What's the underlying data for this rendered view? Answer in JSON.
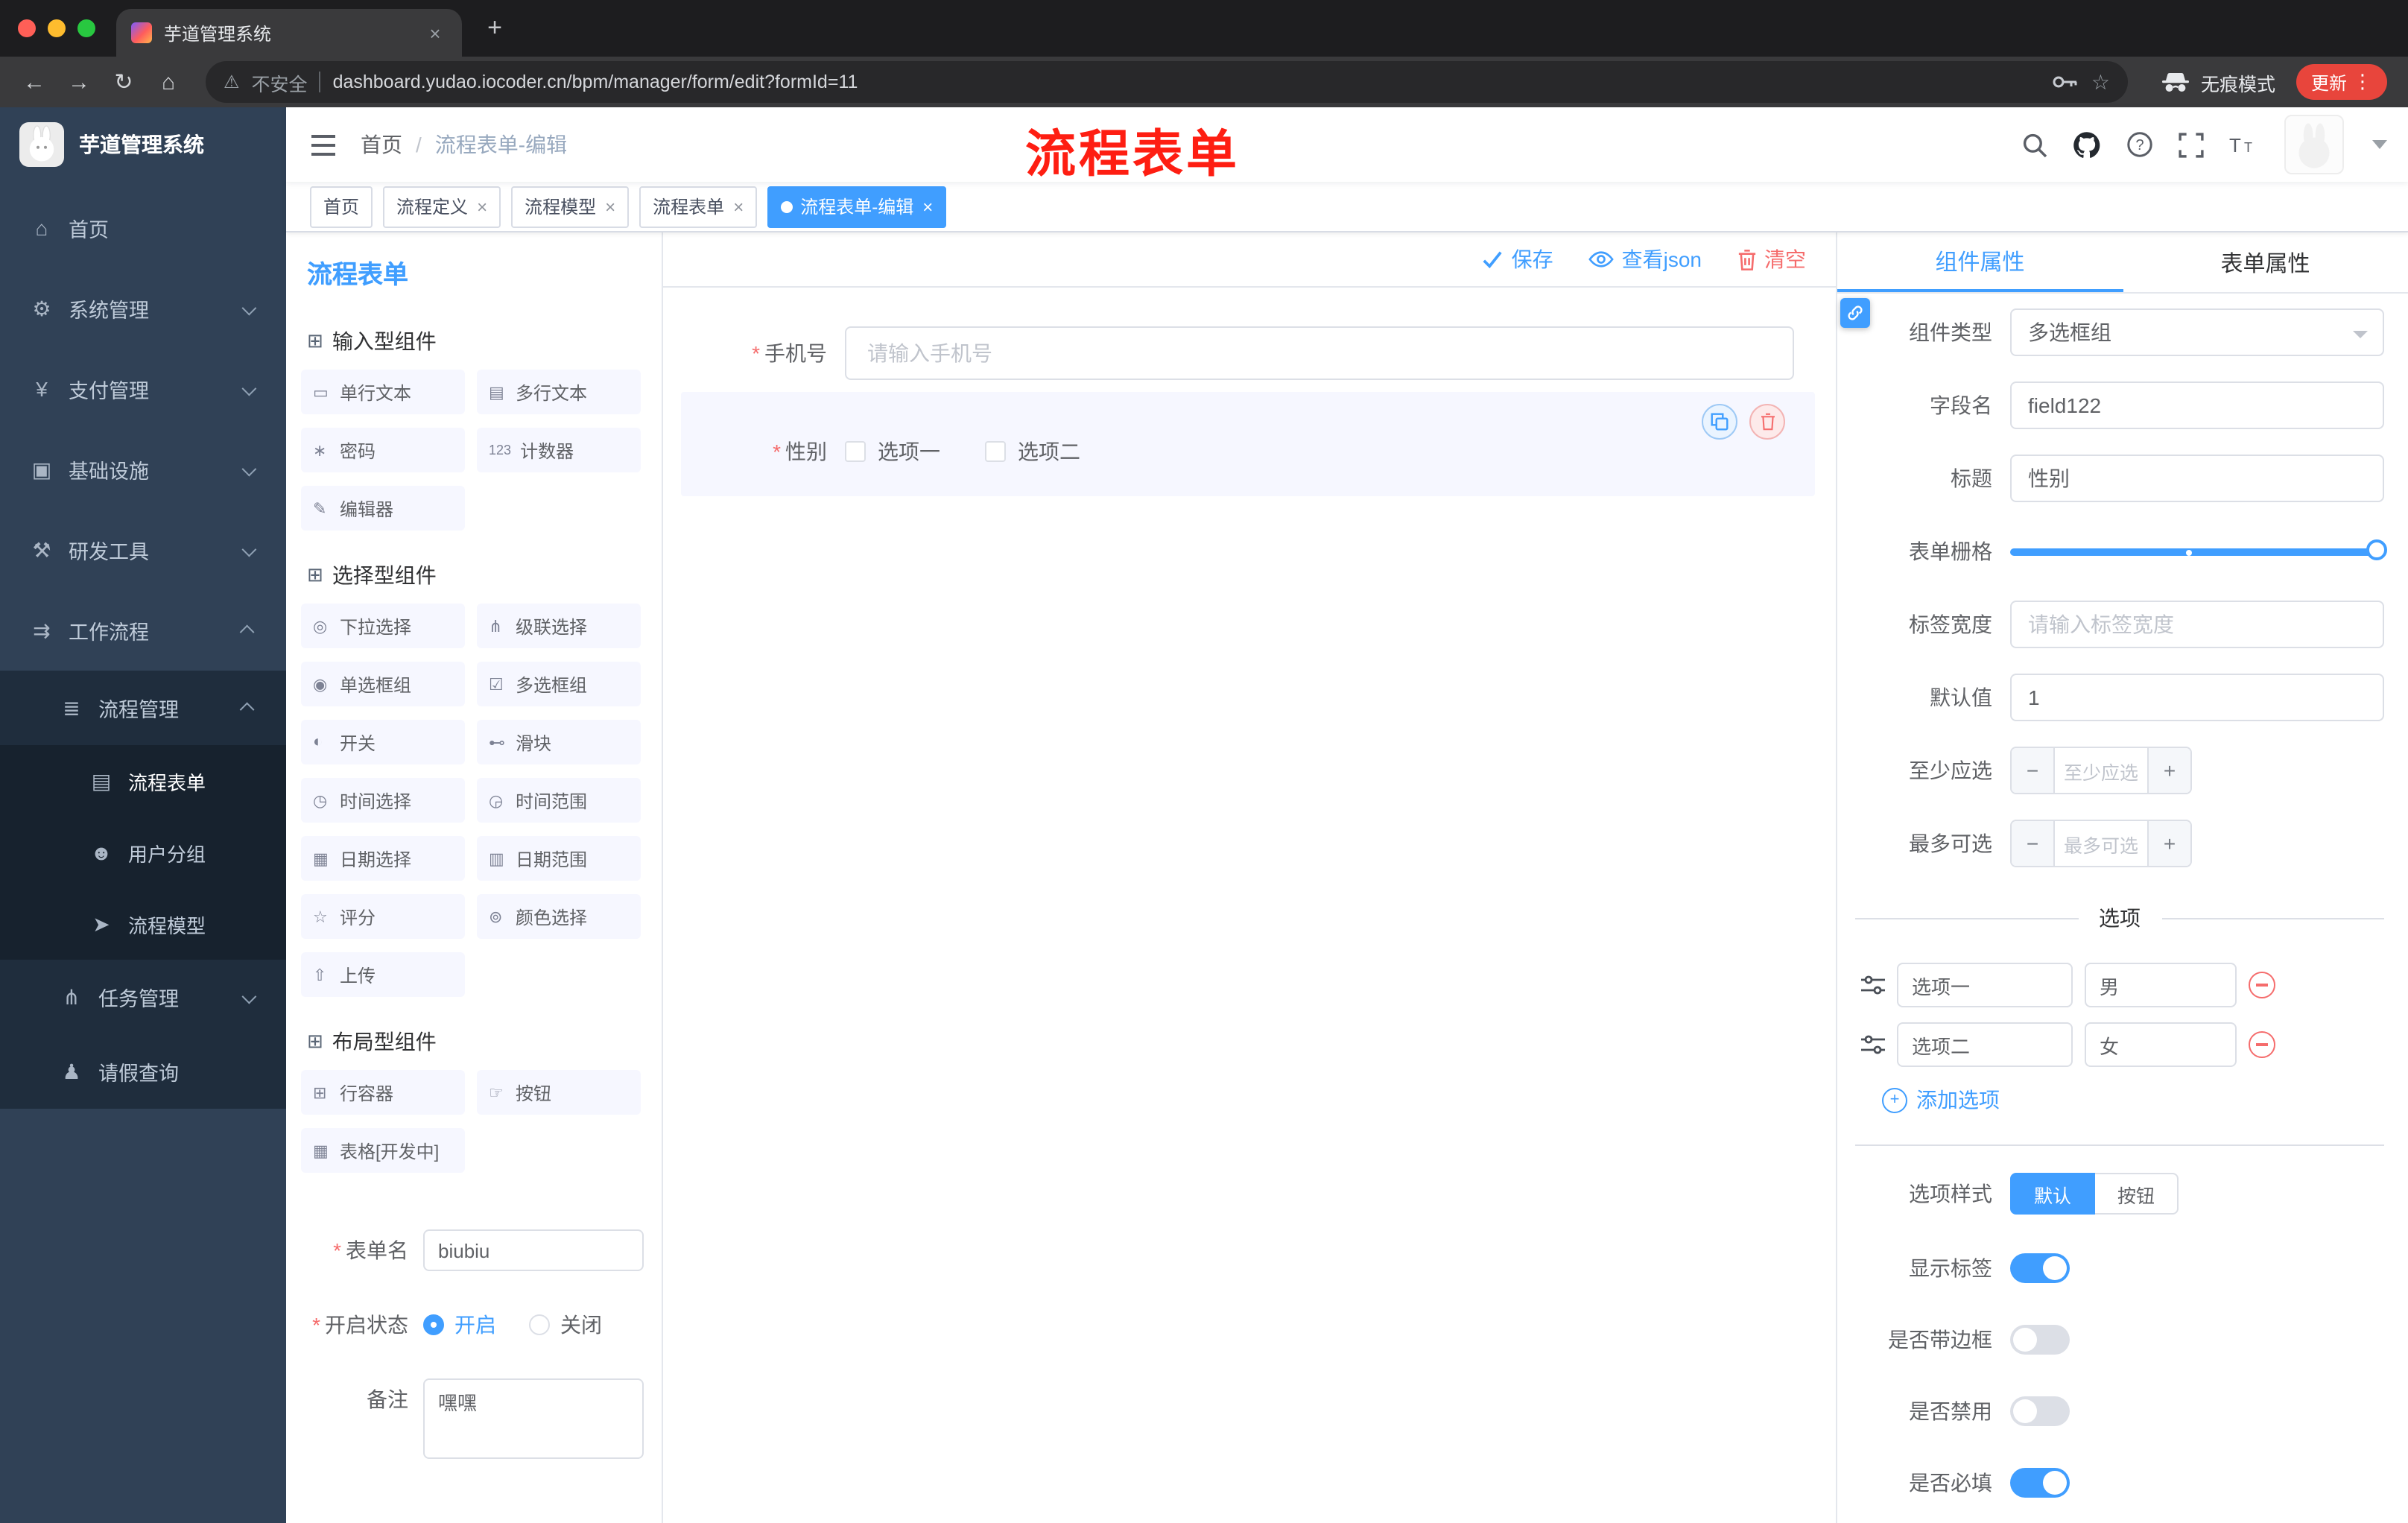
{
  "browser": {
    "tab_title": "芋道管理系统",
    "security_label": "不安全",
    "url": "dashboard.yudao.iocoder.cn/bpm/manager/form/edit?formId=11",
    "incognito_label": "无痕模式",
    "update_label": "更新"
  },
  "annotation": {
    "text": "流程表单"
  },
  "colors": {
    "accent": "#409eff",
    "danger": "#f56c6c",
    "annotation_red": "#fe1e12",
    "sidebar_bg": "#304156",
    "tag_active": "#409eff"
  },
  "sidebar": {
    "logo_title": "芋道管理系统",
    "menu": [
      {
        "label": "首页",
        "glyph": "⌂"
      },
      {
        "label": "系统管理",
        "glyph": "⚙"
      },
      {
        "label": "支付管理",
        "glyph": "¥"
      },
      {
        "label": "基础设施",
        "glyph": "▣"
      },
      {
        "label": "研发工具",
        "glyph": "⚒"
      },
      {
        "label": "工作流程",
        "glyph": "⇉"
      }
    ],
    "process_group": {
      "label": "流程管理",
      "glyph": "≣"
    },
    "process_children": [
      {
        "label": "流程表单",
        "glyph": "▤"
      },
      {
        "label": "用户分组",
        "glyph": "☻"
      },
      {
        "label": "流程模型",
        "glyph": "➤"
      }
    ],
    "task_item": {
      "label": "任务管理",
      "glyph": "⋔"
    },
    "leave_item": {
      "label": "请假查询",
      "glyph": "♟"
    }
  },
  "header": {
    "breadcrumb_home": "首页",
    "breadcrumb_current": "流程表单-编辑"
  },
  "tags": {
    "items": [
      {
        "label": "首页"
      },
      {
        "label": "流程定义"
      },
      {
        "label": "流程模型"
      },
      {
        "label": "流程表单"
      },
      {
        "label": "流程表单-编辑"
      }
    ]
  },
  "builder": {
    "panel_title": "流程表单",
    "actions": {
      "save": "保存",
      "view_json": "查看json",
      "clear": "清空"
    },
    "sections": [
      {
        "title": "输入型组件",
        "items": [
          {
            "label": "单行文本",
            "glyph": "▭"
          },
          {
            "label": "多行文本",
            "glyph": "▤"
          },
          {
            "label": "密码",
            "glyph": "∗"
          },
          {
            "label": "计数器",
            "glyph": "123"
          },
          {
            "label": "编辑器",
            "glyph": "✎"
          }
        ]
      },
      {
        "title": "选择型组件",
        "items": [
          {
            "label": "下拉选择",
            "glyph": "◎"
          },
          {
            "label": "级联选择",
            "glyph": "⋔"
          },
          {
            "label": "单选框组",
            "glyph": "◉"
          },
          {
            "label": "多选框组",
            "glyph": "☑"
          },
          {
            "label": "开关",
            "glyph": "◐"
          },
          {
            "label": "滑块",
            "glyph": "⊷"
          },
          {
            "label": "时间选择",
            "glyph": "◷"
          },
          {
            "label": "时间范围",
            "glyph": "◶"
          },
          {
            "label": "日期选择",
            "glyph": "▦"
          },
          {
            "label": "日期范围",
            "glyph": "▥"
          },
          {
            "label": "评分",
            "glyph": "☆"
          },
          {
            "label": "颜色选择",
            "glyph": "⊚"
          },
          {
            "label": "上传",
            "glyph": "⇧"
          }
        ]
      },
      {
        "title": "布局型组件",
        "items": [
          {
            "label": "行容器",
            "glyph": "⊞"
          },
          {
            "label": "按钮",
            "glyph": "☞"
          },
          {
            "label": "表格[开发中]",
            "glyph": "▦"
          }
        ]
      }
    ],
    "meta": {
      "form_name_label": "表单名",
      "form_name_value": "biubiu",
      "status_label": "开启状态",
      "status_on": "开启",
      "status_off": "关闭",
      "remark_label": "备注",
      "remark_value": "嘿嘿"
    },
    "canvas": {
      "phone_label": "手机号",
      "phone_placeholder": "请输入手机号",
      "gender_label": "性别",
      "gender_opt1": "选项一",
      "gender_opt2": "选项二"
    }
  },
  "props": {
    "tab_component": "组件属性",
    "tab_form": "表单属性",
    "component_type_label": "组件类型",
    "component_type_value": "多选框组",
    "field_name_label": "字段名",
    "field_name_value": "field122",
    "title_label": "标题",
    "title_value": "性别",
    "grid_label": "表单栅格",
    "label_width_label": "标签宽度",
    "label_width_placeholder": "请输入标签宽度",
    "default_label": "默认值",
    "default_value": "1",
    "min_label": "至少应选",
    "min_placeholder": "至少应选",
    "max_label": "最多可选",
    "max_placeholder": "最多可选",
    "options_divider": "选项",
    "options": [
      {
        "name": "选项一",
        "value": "男"
      },
      {
        "name": "选项二",
        "value": "女"
      }
    ],
    "add_option": "添加选项",
    "style_label": "选项样式",
    "style_default": "默认",
    "style_button": "按钮",
    "switch_show_label": "显示标签",
    "switch_border": "是否带边框",
    "switch_disabled": "是否禁用",
    "switch_required": "是否必填"
  }
}
